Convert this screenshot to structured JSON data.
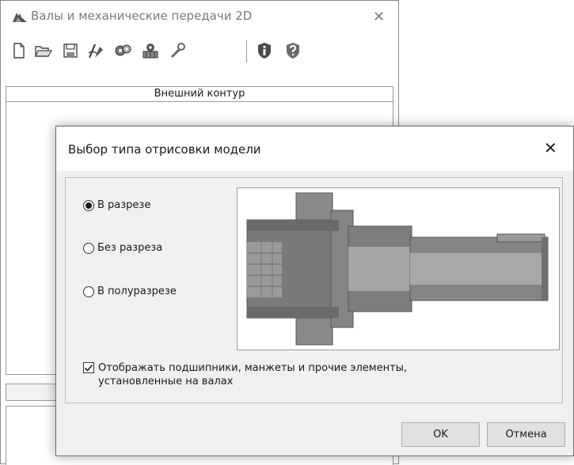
{
  "main_window": {
    "title": "Валы и механические передачи 2D",
    "close_glyph": "✕",
    "toolbar": [
      {
        "name": "new-document-icon"
      },
      {
        "name": "open-folder-icon"
      },
      {
        "name": "save-icon"
      },
      {
        "name": "drawing-tools-icon"
      },
      {
        "name": "gear-settings-icon"
      },
      {
        "name": "gear-library-icon"
      },
      {
        "name": "wrench-icon"
      },
      {
        "name": "info-shield-icon"
      },
      {
        "name": "help-shield-icon"
      }
    ],
    "column_header": "Внешний контур"
  },
  "dialog": {
    "title": "Выбор типа отрисовки модели",
    "close_glyph": "✕",
    "options": [
      {
        "label": "В разрезе",
        "selected": true
      },
      {
        "label": "Без разреза",
        "selected": false
      },
      {
        "label": "В полуразрезе",
        "selected": false
      }
    ],
    "checkbox": {
      "line1": "Отображать подшипники, манжеты и прочие элементы,",
      "line2": "установленные на валах",
      "checked": true
    },
    "ok_label": "OK",
    "cancel_label": "Отмена"
  }
}
